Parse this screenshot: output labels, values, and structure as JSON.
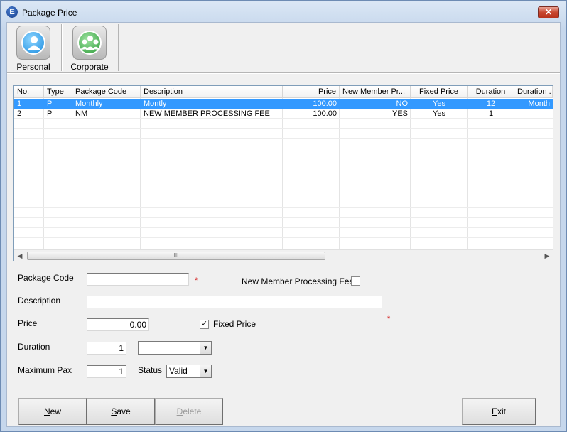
{
  "window": {
    "title": "Package Price",
    "icon_letter": "E",
    "close_glyph": "✕"
  },
  "toolbar": {
    "items": [
      {
        "label": "Personal",
        "icon": "person-icon"
      },
      {
        "label": "Corporate",
        "icon": "group-icon"
      }
    ]
  },
  "grid": {
    "columns": [
      "No.",
      "Type",
      "Package Code",
      "Description",
      "Price",
      "New Member Pr...",
      "Fixed Price",
      "Duration",
      "Duration ."
    ],
    "rows": [
      [
        "1",
        "P",
        "Monthly",
        "Montly",
        "100.00",
        "NO",
        "Yes",
        "12",
        "Month"
      ],
      [
        "2",
        "P",
        "NM",
        "NEW MEMBER PROCESSING FEE",
        "100.00",
        "YES",
        "Yes",
        "1",
        ""
      ]
    ],
    "selected_row": 0,
    "scroll_grip": "III"
  },
  "form": {
    "package_code": {
      "label": "Package Code",
      "value": ""
    },
    "new_member_fee": {
      "label": "New Member Processing Fee",
      "checked": false
    },
    "description": {
      "label": "Description",
      "value": ""
    },
    "price": {
      "label": "Price",
      "value": "0.00"
    },
    "fixed_price": {
      "label": "Fixed Price",
      "checked": true,
      "check_glyph": "✓"
    },
    "duration": {
      "label": "Duration",
      "value": "1",
      "unit": ""
    },
    "maximum_pax": {
      "label": "Maximum Pax",
      "value": "1"
    },
    "status": {
      "label": "Status",
      "value": "Valid"
    },
    "required_mark": "*"
  },
  "buttons": {
    "new": {
      "mnemonic": "N",
      "rest": "ew"
    },
    "save": {
      "mnemonic": "S",
      "rest": "ave"
    },
    "delete": {
      "mnemonic": "D",
      "rest": "elete"
    },
    "exit": {
      "mnemonic": "E",
      "rest": "xit"
    }
  },
  "colors": {
    "selection": "#3399ff",
    "required": "#d00000"
  }
}
